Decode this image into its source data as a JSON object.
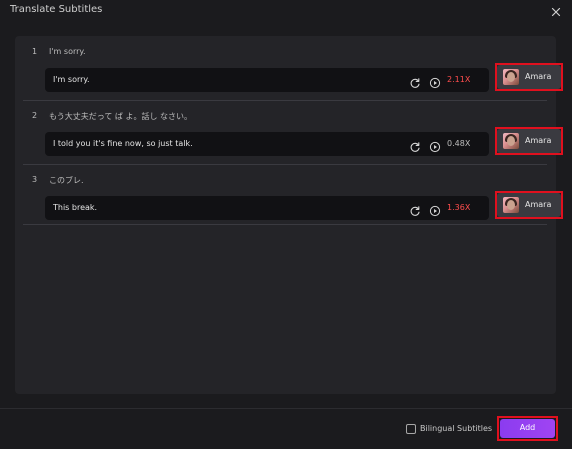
{
  "window": {
    "title": "Translate Subtitles",
    "close_icon": "close-icon"
  },
  "subtitles": [
    {
      "index": "1",
      "source": "I'm sorry.",
      "translation": "I'm sorry.",
      "speed": "2.11X",
      "speed_color": "#ff4d4d",
      "voice": "Amara"
    },
    {
      "index": "2",
      "source": "もう大丈夫だって ば よ。話し なさい。",
      "translation": "I told you it's fine now, so just talk.",
      "speed": "0.48X",
      "speed_color": "#bdbdbd",
      "voice": "Amara"
    },
    {
      "index": "3",
      "source": "このブレ.",
      "translation": "This break.",
      "speed": "1.36X",
      "speed_color": "#ff4d4d",
      "voice": "Amara"
    }
  ],
  "footer": {
    "bilingual_label": "Bilingual Subtitles",
    "bilingual_checked": false,
    "add_label": "Add"
  },
  "colors": {
    "accent": "#8b3cf0",
    "highlight": "#e0101e"
  }
}
